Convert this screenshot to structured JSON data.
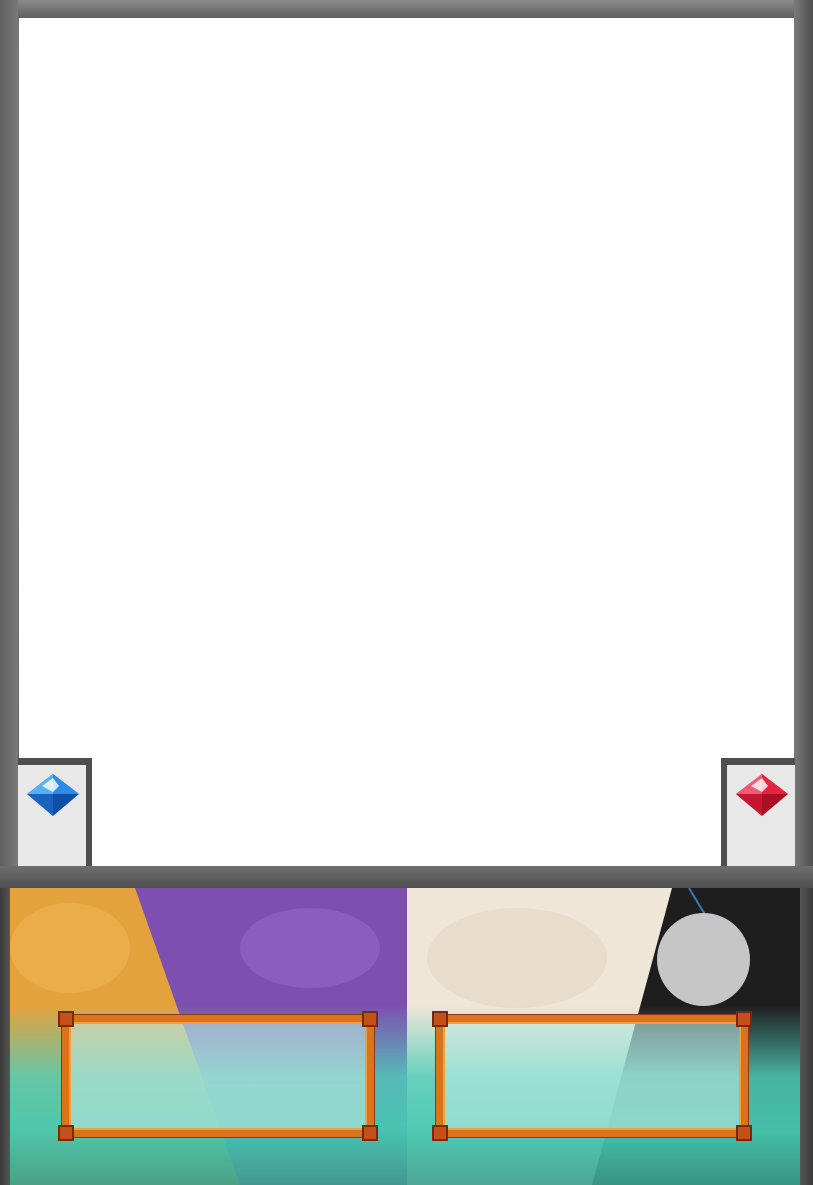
{
  "card": {
    "frame_color": "#5e5e5e",
    "art_background": "#ffffff",
    "text_background": "#ffffff"
  },
  "gems": {
    "left": {
      "icon": "blue-gem-icon",
      "color": "#1e73d2"
    },
    "right": {
      "icon": "red-gem-icon",
      "color": "#e0203a"
    }
  },
  "bottom_panel": {
    "left_colors": [
      "#e4a23c",
      "#7d4fb0"
    ],
    "right_colors": [
      "#efe6d8",
      "#1e1e1e"
    ],
    "accent_teal": "#4fcdb9",
    "frame_color": "#d9731c",
    "orb_color": "#c6c6c6"
  }
}
